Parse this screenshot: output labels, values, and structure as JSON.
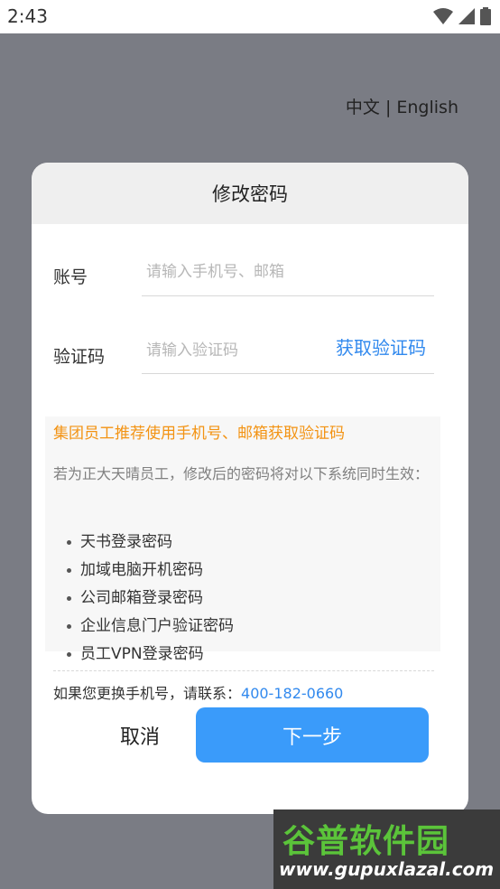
{
  "statusbar": {
    "time": "2:43"
  },
  "language": {
    "label": "中文 | English"
  },
  "dialog": {
    "title": "修改密码",
    "account": {
      "label": "账号",
      "placeholder": "请输入手机号、邮箱"
    },
    "code": {
      "label": "验证码",
      "placeholder": "请输入验证码",
      "get_code": "获取验证码"
    },
    "notice": {
      "warning": "集团员工推荐使用手机号、邮箱获取验证码",
      "description": "若为正大天晴员工，修改后的密码将对以下系统同时生效：",
      "items": [
        "天书登录密码",
        "加域电脑开机密码",
        "公司邮箱登录密码",
        "企业信息门户验证密码",
        "员工VPN登录密码"
      ]
    },
    "contact": {
      "text": "如果您更换手机号，请联系：",
      "phone": "400-182-0660"
    },
    "buttons": {
      "cancel": "取消",
      "next": "下一步"
    }
  },
  "watermark": {
    "title": "谷普软件园",
    "url": "www.gupuxlazal.com"
  },
  "colors": {
    "accent": "#3a9bfa",
    "link": "#3189ee",
    "warning": "#f39313"
  }
}
